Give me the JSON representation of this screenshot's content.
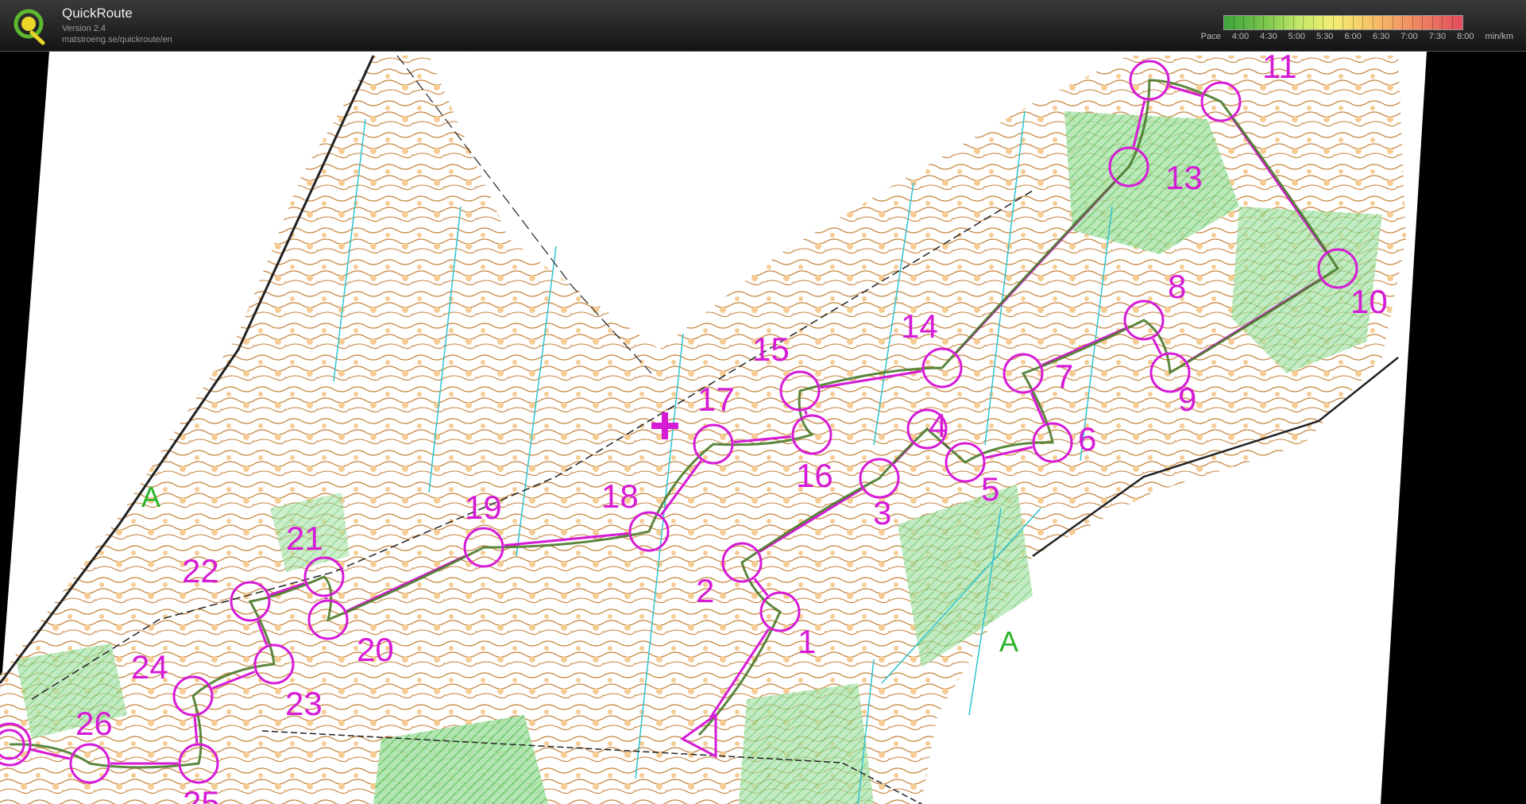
{
  "app": {
    "name": "QuickRoute",
    "version": "Version 2.4",
    "url": "matstroeng.se/quickroute/en",
    "logo_letter": "Q"
  },
  "legend": {
    "label": "Pace",
    "ticks": [
      "4:00",
      "4:30",
      "5:00",
      "5:30",
      "6:00",
      "6:30",
      "7:00",
      "7:30",
      "8:00"
    ],
    "unit": "min/km"
  },
  "map": {
    "control_numbers": [
      "1",
      "2",
      "3",
      "4",
      "5",
      "6",
      "7",
      "8",
      "9",
      "10",
      "11",
      "13",
      "14",
      "15",
      "16",
      "17",
      "18",
      "19",
      "20",
      "21",
      "22",
      "23",
      "24",
      "25",
      "26"
    ],
    "start_marker_label": "A"
  },
  "colors": {
    "course": "#d61bd6",
    "route": "#4a7a2a",
    "contour": "#b8762a",
    "open_land": "#f6c98e",
    "vegetation": "#8fd88f",
    "water_lines": "#2ec3cf"
  }
}
